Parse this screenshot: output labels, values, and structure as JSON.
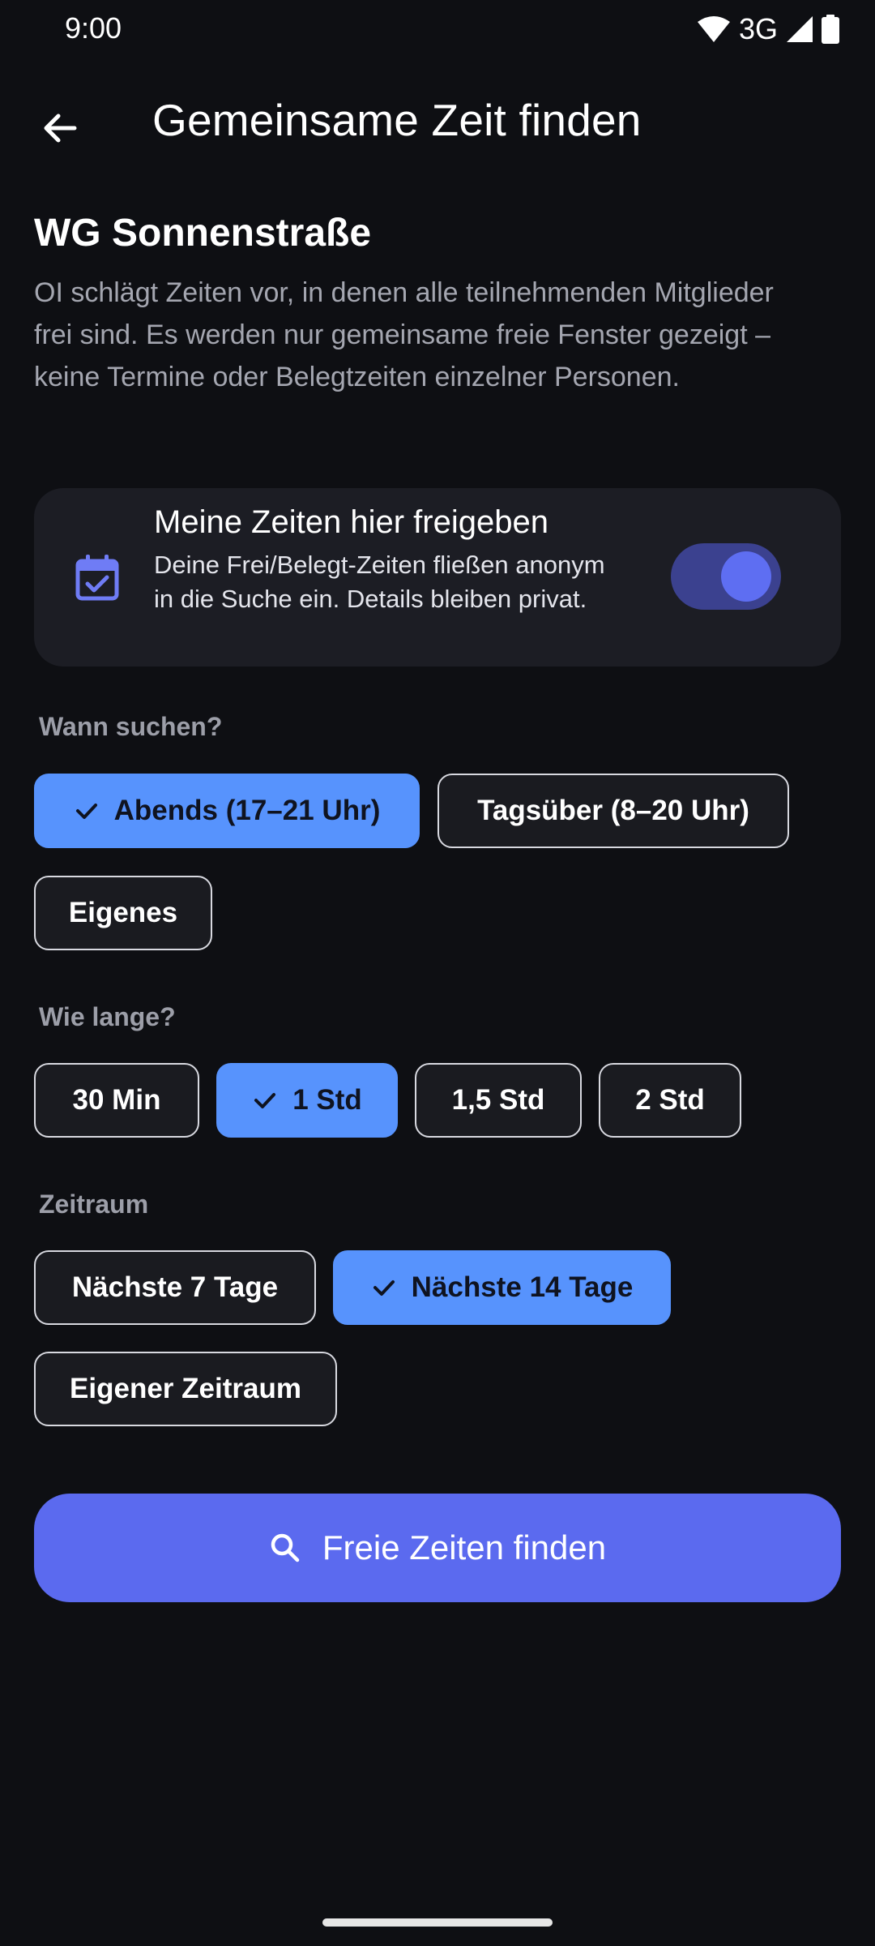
{
  "status_bar": {
    "time": "9:00",
    "network": "3G",
    "icons": [
      "wifi-icon",
      "signal-icon",
      "battery-icon"
    ]
  },
  "app_bar": {
    "title": "Gemeinsame Zeit finden",
    "back_icon": "arrow-left-icon"
  },
  "group": {
    "name": "WG Sonnenstraße",
    "intro": "OI schlägt Zeiten vor, in denen alle teilnehmenden Mitglieder frei sind. Es werden nur gemeinsame freie Fenster gezeigt – keine Termine oder Belegtzeiten einzelner Personen."
  },
  "share": {
    "title": "Meine Zeiten hier freigeben",
    "description": "Deine Frei/Belegt-Zeiten fließen anonym in die Suche ein. Details bleiben privat.",
    "icon": "calendar-check-icon",
    "enabled": true
  },
  "when": {
    "label": "Wann suchen?",
    "options": [
      {
        "label": "Abends (17–21 Uhr)",
        "selected": true
      },
      {
        "label": "Tagsüber (8–20 Uhr)",
        "selected": false
      },
      {
        "label": "Eigenes",
        "selected": false
      }
    ]
  },
  "duration": {
    "label": "Wie lange?",
    "options": [
      {
        "label": "30 Min",
        "selected": false
      },
      {
        "label": "1 Std",
        "selected": true
      },
      {
        "label": "1,5 Std",
        "selected": false
      },
      {
        "label": "2 Std",
        "selected": false
      }
    ]
  },
  "range": {
    "label": "Zeitraum",
    "options": [
      {
        "label": "Nächste 7 Tage",
        "selected": false
      },
      {
        "label": "Nächste 14 Tage",
        "selected": true
      },
      {
        "label": "Eigener Zeitraum",
        "selected": false
      }
    ]
  },
  "action": {
    "label": "Freie Zeiten finden",
    "icon": "search-icon"
  },
  "colors": {
    "background": "#0e0f13",
    "card": "#1c1d24",
    "chip_selected": "#5793fd",
    "primary": "#5b6aef",
    "toggle_track": "#3b418f",
    "toggle_knob": "#5e6ef2"
  }
}
